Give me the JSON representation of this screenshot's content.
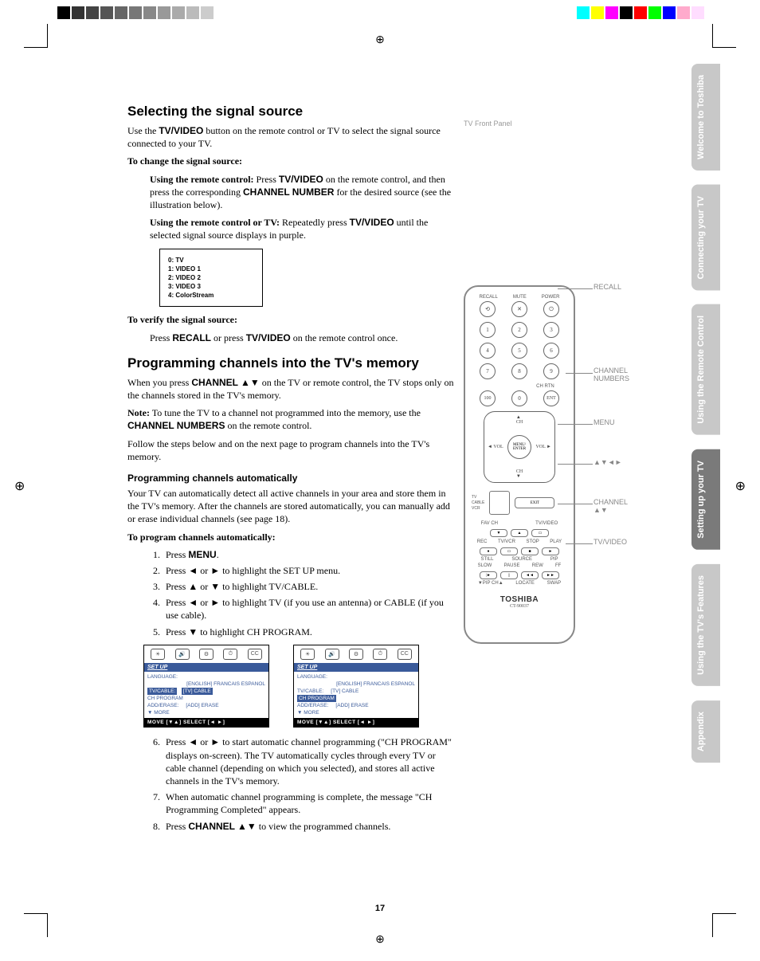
{
  "headings": {
    "h1": "Selecting the signal source",
    "h2": "Programming channels into the TV's memory",
    "sub1": "Programming channels automatically"
  },
  "body": {
    "p1a": "Use the ",
    "p1b": " button on the remote control or TV to select the signal source connected to your TV.",
    "p2": "To change the signal source:",
    "p3a": "Using the remote control:",
    "p3b": " Press ",
    "p3c": " on the remote control, and then press the corresponding ",
    "p3d": " for the desired source (see the illustration below).",
    "p4a": "Using the remote control or TV:",
    "p4b": " Repeatedly press ",
    "p4c": " until the selected signal source displays in purple.",
    "p5": "To verify the signal source:",
    "p6a": "Press ",
    "p6b": " or press ",
    "p6c": " on the remote control once.",
    "p7a": "When you press ",
    "p7b": " ▲▼ on the TV or remote control, the TV stops only on the channels stored in the TV's memory.",
    "p8a": "Note:",
    "p8b": " To tune the TV to a channel not programmed into the memory, use the ",
    "p8c": " on the remote control.",
    "p9": "Follow the steps below and on the next page to program channels into the TV's memory.",
    "p10": "Your TV can automatically detect all active channels in your area and store them in the TV's memory. After the channels are stored automatically, you can manually add or erase individual channels (see page 18).",
    "p11": "To program channels automatically:"
  },
  "bold_terms": {
    "tvvideo": "TV/VIDEO",
    "channel_number": "CHANNEL NUMBER",
    "recall": "RECALL",
    "channel": "CHANNEL",
    "channel_numbers": "CHANNEL NUMBERS",
    "menu": "MENU"
  },
  "signal_list": {
    "l0": "0: TV",
    "l1": "1: VIDEO 1",
    "l2": "2: VIDEO 2",
    "l3": "3: VIDEO 3",
    "l4": "4: ColorStream"
  },
  "steps": {
    "s1a": "Press ",
    "s1b": ".",
    "s2": "Press ◄ or ► to highlight the SET UP menu.",
    "s3": "Press ▲ or ▼ to highlight TV/CABLE.",
    "s4": "Press ◄ or ► to highlight TV (if you use an antenna) or CABLE (if you use cable).",
    "s5": "Press ▼ to highlight CH PROGRAM.",
    "s6": "Press ◄ or ► to start automatic channel programming (\"CH PROGRAM\" displays on-screen). The TV automatically cycles through every TV or cable channel (depending on which you selected), and stores all active channels in the TV's memory.",
    "s7": "When automatic channel programming is complete, the message \"CH Programming Completed\" appears.",
    "s8a": "Press ",
    "s8b": " ▲▼ to view the programmed channels."
  },
  "menu": {
    "title": "SET UP",
    "lang": "LANGUAGE:",
    "lang_opts": "[ENGLISH] FRANCAIS ESPANOL",
    "tvcable": "TV/CABLE:",
    "tvcable_opts": "[TV] CABLE",
    "chprog": "CH PROGRAM",
    "adderase": "ADD/ERASE:",
    "adderase_opts": "[ADD] ERASE",
    "more": "▼ MORE",
    "footer": "MOVE [▼▲]    SELECT [◄ ►]",
    "cc": "CC"
  },
  "right": {
    "front_panel": "TV Front Panel"
  },
  "remote": {
    "recall": "RECALL",
    "mute": "MUTE",
    "power": "POWER",
    "chrtn": "CH RTN",
    "ent": "ENT",
    "n100": "100",
    "menu_enter": "MENU/\nENTER",
    "ch": "CH",
    "vol": "VOL",
    "tv": "TV",
    "cable": "CABLE",
    "vcr": "VCR",
    "exit": "EXIT",
    "favch": "FAV CH",
    "tvvideo": "TV/VIDEO",
    "rec": "REC",
    "tvvcr": "TV/VCR",
    "stop": "STOP",
    "play": "PLAY",
    "still": "STILL",
    "source": "SOURCE",
    "pip": "PIP",
    "slow": "SLOW",
    "pause": "PAUSE",
    "rew": "REW",
    "ff": "FF",
    "pipch": "▼PIP CH▲",
    "locate": "LOCATE",
    "swap": "SWAP",
    "brand": "TOSHIBA",
    "model": "CT-90037"
  },
  "callouts": {
    "recall": "RECALL",
    "channel_numbers": "CHANNEL\nNUMBERS",
    "menu": "MENU",
    "arrows": "▲▼◄►",
    "channel": "CHANNEL\n▲▼",
    "tvvideo": "TV/VIDEO"
  },
  "tabs": {
    "t1": "Welcome to Toshiba",
    "t2": "Connecting your TV",
    "t3": "Using the Remote Control",
    "t4": "Setting up your TV",
    "t5": "Using the TV's Features",
    "t6": "Appendix"
  },
  "page_number": "17"
}
